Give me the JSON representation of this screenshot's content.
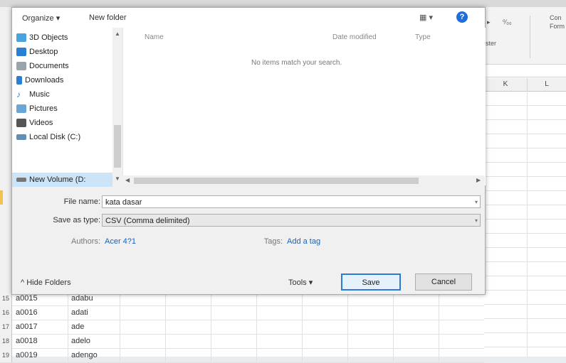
{
  "toolbar": {
    "organize": "Organize ▾",
    "new_folder": "New folder",
    "view_icon": "view-list-icon",
    "view_label": "▦ ▾",
    "help": "?"
  },
  "nav": {
    "items": [
      {
        "label": "3D Objects",
        "icon": "cube-icon",
        "color": "#4aa3df"
      },
      {
        "label": "Desktop",
        "icon": "desktop-icon",
        "color": "#2a7fd4"
      },
      {
        "label": "Documents",
        "icon": "document-icon",
        "color": "#9aa4ad"
      },
      {
        "label": "Downloads",
        "icon": "download-icon",
        "color": "#2a7fd4"
      },
      {
        "label": "Music",
        "icon": "music-icon",
        "color": "#2a7fd4"
      },
      {
        "label": "Pictures",
        "icon": "pictures-icon",
        "color": "#6aa6d6"
      },
      {
        "label": "Videos",
        "icon": "video-icon",
        "color": "#555"
      },
      {
        "label": "Local Disk (C:)",
        "icon": "drive-icon",
        "color": "#5f8fb8"
      },
      {
        "label": "New Volume (D:",
        "icon": "drive-icon",
        "color": "#777"
      }
    ]
  },
  "files": {
    "col_name": "Name",
    "col_date": "Date modified",
    "col_type": "Type",
    "empty": "No items match your search."
  },
  "form": {
    "filename_label": "File name:",
    "filename_value": "kata dasar",
    "type_label": "Save as type:",
    "type_value": "CSV (Comma delimited)",
    "authors_label": "Authors:",
    "authors_value": "Acer 4?1",
    "tags_label": "Tags:",
    "tags_value": "Add a tag"
  },
  "footer": {
    "hide_folders": "Hide Folders",
    "tools": "Tools",
    "save": "Save",
    "cancel": "Cancel"
  },
  "excel": {
    "ribbon": {
      "cond_format": "Con",
      "format": "Form",
      "text1": "ster"
    },
    "columns": [
      "K",
      "L"
    ],
    "rows": [
      {
        "n": "15",
        "a": "a0015",
        "b": "adabu"
      },
      {
        "n": "16",
        "a": "a0016",
        "b": "adati"
      },
      {
        "n": "17",
        "a": "a0017",
        "b": "ade"
      },
      {
        "n": "18",
        "a": "a0018",
        "b": "adelo"
      },
      {
        "n": "19",
        "a": "a0019",
        "b": "adengo"
      }
    ]
  }
}
